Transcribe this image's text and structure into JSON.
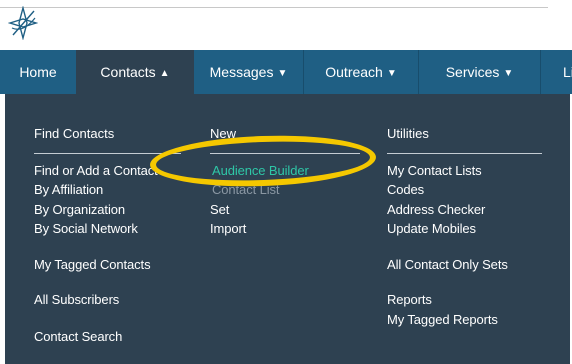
{
  "nav": {
    "items": [
      {
        "label": "Home"
      },
      {
        "label": "Contacts",
        "chevron": "▲"
      },
      {
        "label": "Messages",
        "chevron": "▼"
      },
      {
        "label": "Outreach",
        "chevron": "▼"
      },
      {
        "label": "Services",
        "chevron": "▼"
      },
      {
        "label": "Li"
      }
    ]
  },
  "menu": {
    "find": {
      "title": "Find Contacts",
      "items": [
        "Find or Add a Contact",
        "By Affiliation",
        "By Organization",
        "By Social Network",
        "My Tagged Contacts",
        "All Subscribers",
        "Contact Search"
      ]
    },
    "new": {
      "title": "New",
      "items": [
        "Audience Builder",
        "Contact List",
        "Set",
        "Import"
      ]
    },
    "utilities": {
      "title": "Utilities",
      "items": [
        "My Contact Lists",
        "Codes",
        "Address Checker",
        "Update Mobiles",
        "All Contact Only Sets",
        "Reports",
        "My Tagged Reports"
      ]
    }
  },
  "colors": {
    "nav_bg": "#1f5f84",
    "panel_bg": "#2e4151",
    "highlight_link": "#2ec7a7",
    "annotation_circle": "#f5c800"
  },
  "icons": {
    "logo": "compass-star-logo-icon",
    "chevron_up": "chevron-up-icon",
    "chevron_down": "chevron-down-icon"
  }
}
